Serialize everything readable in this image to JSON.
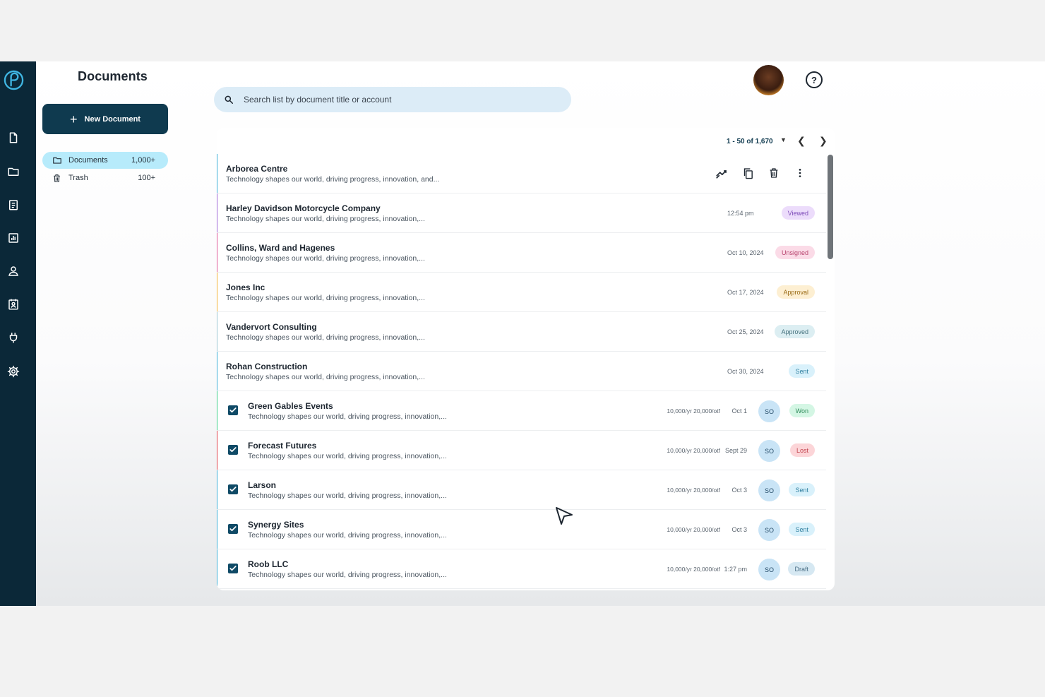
{
  "app": {
    "page_title": "Documents",
    "new_document_label": "New Document",
    "search_placeholder": "Search list by document title or account",
    "help_label": "?"
  },
  "nav": [
    "documents-icon",
    "folder-icon",
    "clipboard-icon",
    "analytics-icon",
    "contacts-icon",
    "contact-card-icon",
    "integrations-icon",
    "settings-icon"
  ],
  "folders": [
    {
      "label": "Documents",
      "count": "1,000+"
    },
    {
      "label": "Trash",
      "count": "100+"
    }
  ],
  "pager": {
    "range": "1 - 50 of 1,670"
  },
  "rows": [
    {
      "title": "Arborea Centre",
      "desc": "Technology shapes our world, driving progress, innovation, and...",
      "color": "#3fb0d8"
    },
    {
      "title": "Harley Davidson Motorcycle Company",
      "desc": "Technology shapes our world, driving progress, innovation,...",
      "date": "12:54 pm",
      "status": "Viewed",
      "color": "#a06ad8"
    },
    {
      "title": "Collins, Ward and Hagenes",
      "desc": "Technology shapes our world, driving progress, innovation,...",
      "date": "Oct 10, 2024",
      "status": "Unsigned",
      "color": "#e05a9a"
    },
    {
      "title": "Jones Inc",
      "desc": "Technology shapes our world, driving progress, innovation,...",
      "date": "Oct 17, 2024",
      "status": "Approval",
      "color": "#f2b53a"
    },
    {
      "title": "Vandervort Consulting",
      "desc": "Technology shapes our world, driving progress, innovation,...",
      "date": "Oct 25, 2024",
      "status": "Approved",
      "color": "#9fc8d4"
    },
    {
      "title": "Rohan Construction",
      "desc": "Technology shapes our world, driving progress, innovation,...",
      "date": "Oct 30, 2024",
      "status": "Sent",
      "color": "#3fb0d8"
    },
    {
      "title": "Green Gables Events",
      "desc": "Technology shapes our world, driving progress, innovation,...",
      "amount": "10,000/yr 20,000/otf",
      "date": "Oct 1",
      "owner": "SO",
      "status": "Won",
      "color": "#3fd08a",
      "checked": true
    },
    {
      "title": "Forecast Futures",
      "desc": "Technology shapes our world, driving progress, innovation,...",
      "amount": "10,000/yr 20,000/otf",
      "date": "Sept 29",
      "owner": "SO",
      "status": "Lost",
      "color": "#e0444e",
      "checked": true
    },
    {
      "title": "Larson",
      "desc": "Technology shapes our world, driving progress, innovation,...",
      "amount": "10,000/yr 20,000/otf",
      "date": "Oct 3",
      "owner": "SO",
      "status": "Sent",
      "color": "#3fb0d8",
      "checked": true
    },
    {
      "title": "Synergy Sites",
      "desc": "Technology shapes our world, driving progress, innovation,...",
      "amount": "10,000/yr 20,000/otf",
      "date": "Oct 3",
      "owner": "SO",
      "status": "Sent",
      "color": "#3fb0d8",
      "checked": true
    },
    {
      "title": "Roob LLC",
      "desc": "Technology shapes our world, driving progress, innovation,...",
      "amount": "10,000/yr 20,000/otf",
      "date": "1:27 pm",
      "owner": "SO",
      "status": "Draft",
      "color": "#3fb0d8",
      "checked": true
    }
  ],
  "row_actions": [
    "analytics-icon",
    "copy-icon",
    "delete-icon",
    "more-vert-icon"
  ],
  "status_colors": {
    "Viewed": {
      "bg": "#ecdcfb",
      "fg": "#7c4ab8"
    },
    "Unsigned": {
      "bg": "#fbdbe7",
      "fg": "#b8456f"
    },
    "Approval": {
      "bg": "#fdefd2",
      "fg": "#9a6b16"
    },
    "Approved": {
      "bg": "#dceef2",
      "fg": "#45717d"
    },
    "Sent": {
      "bg": "#d9f1fb",
      "fg": "#2f7f9f"
    },
    "Won": {
      "bg": "#d4f6e4",
      "fg": "#2f8c5a"
    },
    "Lost": {
      "bg": "#fcd5d8",
      "fg": "#c24650"
    },
    "Draft": {
      "bg": "#d6e8f2",
      "fg": "#4a6f86"
    }
  }
}
